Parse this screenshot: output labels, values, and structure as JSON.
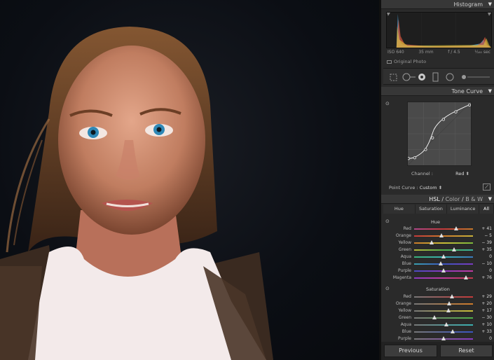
{
  "panels": {
    "histogram": {
      "title": "Histogram",
      "iso": "ISO 640",
      "focal": "35 mm",
      "aperture": "f / 4.5",
      "shutter": "¹⁄₁₆₀ sec",
      "original_photo": "Original Photo"
    },
    "tone_curve": {
      "title": "Tone Curve",
      "channel_label": "Channel :",
      "channel_value": "Red",
      "point_curve_label": "Point Curve :",
      "point_curve_value": "Custom"
    },
    "hsl": {
      "title": "HSL",
      "sep1": "/",
      "color": "Color",
      "sep2": "/",
      "bw": "B & W",
      "tabs": [
        "Hue",
        "Saturation",
        "Luminance",
        "All"
      ],
      "hue_label": "Hue",
      "saturation_label": "Saturation",
      "hue_rows": [
        {
          "name": "Red",
          "value": "+ 41",
          "pos": 0.72
        },
        {
          "name": "Orange",
          "value": "− 5",
          "pos": 0.47
        },
        {
          "name": "Yellow",
          "value": "− 39",
          "pos": 0.3
        },
        {
          "name": "Green",
          "value": "+ 35",
          "pos": 0.68
        },
        {
          "name": "Aqua",
          "value": "0",
          "pos": 0.5
        },
        {
          "name": "Blue",
          "value": "− 10",
          "pos": 0.45
        },
        {
          "name": "Purple",
          "value": "0",
          "pos": 0.5
        },
        {
          "name": "Magenta",
          "value": "+ 76",
          "pos": 0.88
        }
      ],
      "sat_rows": [
        {
          "name": "Red",
          "value": "+ 29",
          "pos": 0.64
        },
        {
          "name": "Orange",
          "value": "+ 20",
          "pos": 0.6
        },
        {
          "name": "Yellow",
          "value": "+ 17",
          "pos": 0.58
        },
        {
          "name": "Green",
          "value": "− 30",
          "pos": 0.35
        },
        {
          "name": "Aqua",
          "value": "+ 10",
          "pos": 0.55
        },
        {
          "name": "Blue",
          "value": "+ 33",
          "pos": 0.66
        },
        {
          "name": "Purple",
          "value": "0",
          "pos": 0.5
        }
      ]
    }
  },
  "buttons": {
    "previous": "Previous",
    "reset": "Reset"
  },
  "colors": {
    "panel_bg": "#2a2a2a",
    "header_bg": "#373737",
    "photo_bg": "#0d1118"
  }
}
